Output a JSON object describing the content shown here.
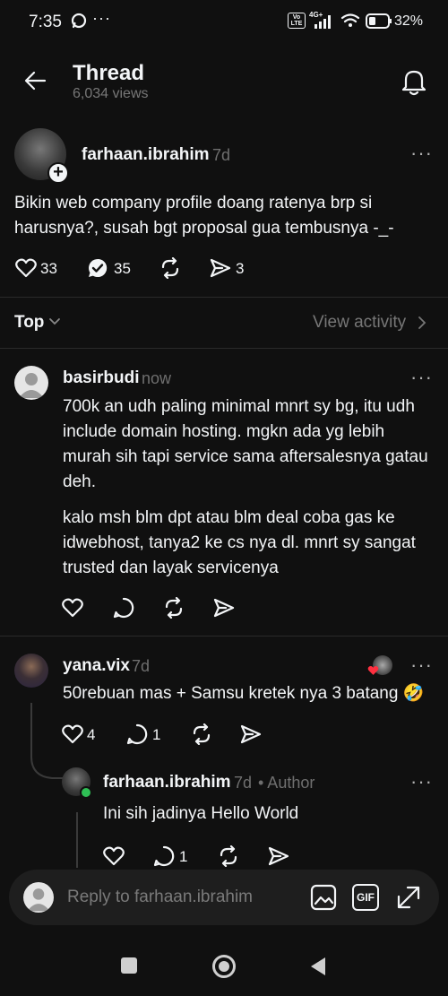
{
  "status_bar": {
    "time": "7:35",
    "network": "4G+",
    "volte": "Vo LTE",
    "battery": "32%"
  },
  "header": {
    "title": "Thread",
    "views": "6,034 views"
  },
  "main_post": {
    "username": "farhaan.ibrahim",
    "time": "7d",
    "text": "Bikin web company profile doang ratenya brp si harusnya?, susah bgt proposal gua tembusnya -_-",
    "likes": "33",
    "replies": "35",
    "shares": "3"
  },
  "sort": {
    "label": "Top",
    "view_activity": "View activity"
  },
  "replies": [
    {
      "username": "basirbudi",
      "time": "now",
      "paragraph1": "700k an udh paling minimal mnrt sy bg, itu udh include domain hosting. mgkn ada yg lebih murah sih tapi service sama aftersalesnya gatau deh.",
      "paragraph2": "kalo msh blm dpt atau blm deal coba gas ke idwebhost, tanya2 ke cs nya dl. mnrt sy sangat trusted dan layak servicenya"
    },
    {
      "username": "yana.vix",
      "time": "7d",
      "text": "50rebuan mas + Samsu kretek nya 3 batang 🤣",
      "likes": "4",
      "replies": "1"
    },
    {
      "username": "farhaan.ibrahim",
      "time": "7d",
      "author_tag": "• Author",
      "text": "Ini sih jadinya Hello World",
      "replies": "1"
    }
  ],
  "composer": {
    "placeholder": "Reply to farhaan.ibrahim",
    "gif_label": "GIF"
  },
  "colors": {
    "background": "#101010",
    "text": "#f3f5f7",
    "muted": "#777777",
    "composer_bg": "#1e1e1e",
    "online_green": "#2fbf55"
  }
}
